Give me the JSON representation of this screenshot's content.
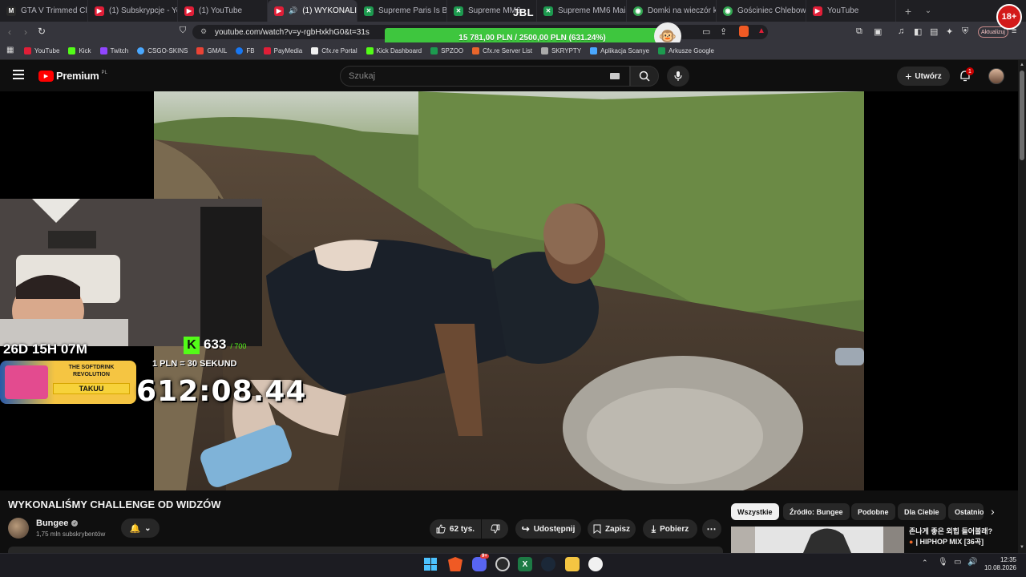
{
  "browser": {
    "tabs": [
      {
        "title": "GTA V Trimmed Clip 1",
        "icon": "kick-icon",
        "color": "#2a2a2a"
      },
      {
        "title": "(1) Subskrypcje - YouT",
        "icon": "youtube-icon",
        "color": "#e01e37"
      },
      {
        "title": "(1) YouTube",
        "icon": "youtube-icon",
        "color": "#e01e37"
      },
      {
        "title": "(1) WYKONALI",
        "icon": "youtube-icon",
        "color": "#e01e37",
        "active": true
      },
      {
        "title": "Supreme Paris Is Burn",
        "icon": "sheets-icon",
        "color": "#1d9a4f"
      },
      {
        "title": "Supreme MM6",
        "icon": "sheets-icon",
        "color": "#1d9a4f"
      },
      {
        "title": "Supreme MM6 Maiso",
        "icon": "sheets-icon",
        "color": "#1d9a4f"
      },
      {
        "title": "Domki na wieczór kaw",
        "icon": "tripadvisor-icon",
        "color": "#34a853"
      },
      {
        "title": "Gościniec Chlebowy Z",
        "icon": "tripadvisor-icon",
        "color": "#34a853"
      },
      {
        "title": "YouTube",
        "icon": "youtube-icon",
        "color": "#e01e37"
      }
    ],
    "new_tab": "+",
    "url": "youtube.com/watch?v=y-rgbHxkhG0&t=31s",
    "update_label": "Aktualizuj",
    "bookmarks": [
      {
        "label": "YouTube",
        "color": "#e01e37"
      },
      {
        "label": "Kick",
        "color": "#53fc18"
      },
      {
        "label": "Twitch",
        "color": "#9146ff"
      },
      {
        "label": "CSGO-SKINS",
        "color": "#4aa8ff"
      },
      {
        "label": "GMAIL",
        "color": "#ea4335"
      },
      {
        "label": "FB",
        "color": "#1877f2"
      },
      {
        "label": "PayMedia",
        "color": "#e01e37"
      },
      {
        "label": "Cfx.re Portal",
        "color": "#f0f0f0"
      },
      {
        "label": "Kick Dashboard",
        "color": "#53fc18"
      },
      {
        "label": "SPZOO",
        "color": "#1d9a4f"
      },
      {
        "label": "Cfx.re Server List",
        "color": "#e8652b"
      },
      {
        "label": "SKRYPTY",
        "color": "#aaaaaa"
      },
      {
        "label": "Aplikacja Scanye",
        "color": "#4aa8ff"
      },
      {
        "label": "Arkusze Google",
        "color": "#1d9a4f"
      }
    ]
  },
  "overlay": {
    "donation_text": "15 781,00 PLN / 2500,00 PLN (631.24%)",
    "donation_progress": 1.0,
    "brand": "JBL",
    "badge": "18+",
    "countdown": "26D 15H 07M",
    "kick_count": "633",
    "kick_goal": "/ 700",
    "rate": "1 PLN = 30 SEKUND",
    "timer": "612:08.44",
    "ad_title": "THE SOFTDRINK REVOLUTION",
    "ad_brand": "TAKUU"
  },
  "youtube": {
    "logo": "Premium",
    "region": "PL",
    "search_placeholder": "Szukaj",
    "create_label": "Utwórz",
    "notification_count": "1",
    "video_title": "WYKONALIŚMY CHALLENGE OD WIDZÓW",
    "channel": {
      "name": "Bungee",
      "subscribers": "1,75 mln subskrybentów"
    },
    "actions": {
      "likes": "62 tys.",
      "share": "Udostępnij",
      "save": "Zapisz",
      "download": "Pobierz"
    },
    "chips": [
      "Wszystkie",
      "Źródło: Bungee",
      "Podobne",
      "Dla Ciebie",
      "Ostatnio"
    ],
    "recommendation": {
      "title_line1": "존나게 좋은 외힙 들어볼래?",
      "title_line2": "| HIPHOP MIX [36곡]"
    }
  },
  "taskbar": {
    "time": "12:35",
    "date": "10.08.2026",
    "discord_badge": "9+"
  }
}
